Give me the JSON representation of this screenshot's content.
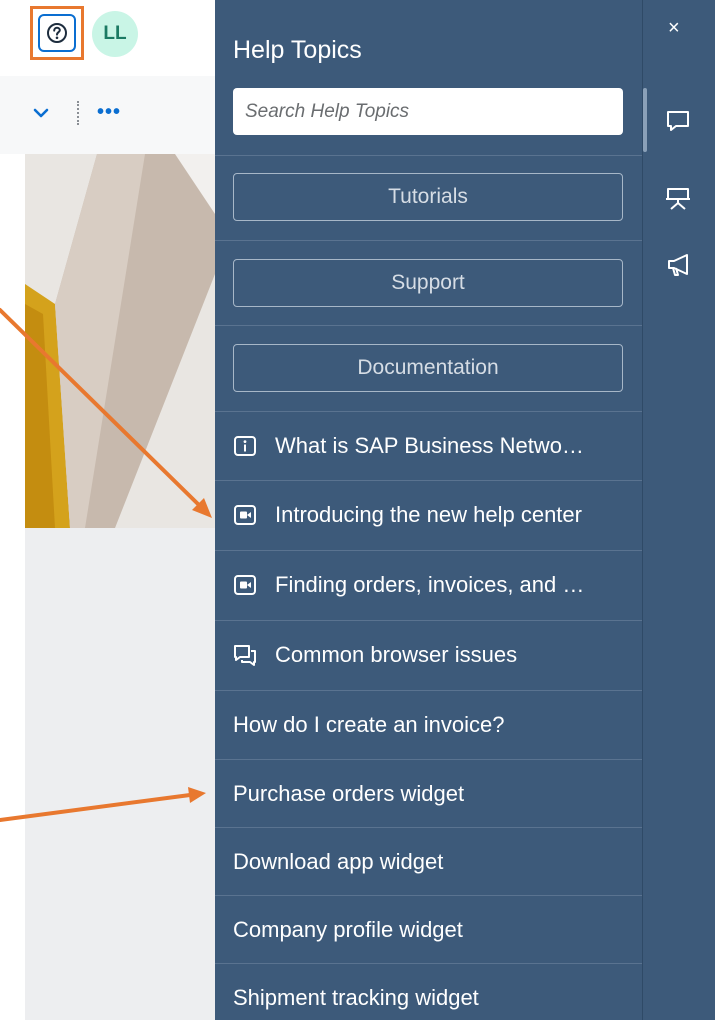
{
  "header": {
    "help_icon": "question-circle-icon",
    "avatar_initials": "LL"
  },
  "toolbar": {
    "chevron_icon": "chevron-down-icon",
    "more_label": "•••"
  },
  "help_panel": {
    "title": "Help Topics",
    "search_placeholder": "Search Help Topics",
    "buttons": [
      {
        "label": "Tutorials"
      },
      {
        "label": "Support"
      },
      {
        "label": "Documentation"
      }
    ],
    "topics": [
      {
        "label": "What is SAP Business Netwo…",
        "icon": "info-icon"
      },
      {
        "label": "Introducing the new help center",
        "icon": "video-icon"
      },
      {
        "label": "Finding orders, invoices, and …",
        "icon": "video-icon"
      },
      {
        "label": "Common browser issues",
        "icon": "conversation-icon"
      },
      {
        "label": "How do I create an invoice?",
        "icon": ""
      },
      {
        "label": "Purchase orders widget",
        "icon": ""
      },
      {
        "label": "Download app widget",
        "icon": ""
      },
      {
        "label": "Company profile widget",
        "icon": ""
      },
      {
        "label": "Shipment tracking widget",
        "icon": ""
      }
    ]
  },
  "rail": {
    "close_label": "×",
    "icons": [
      "feedback-icon",
      "presentation-icon",
      "announcement-icon"
    ]
  },
  "colors": {
    "panel_bg": "#3d5a7a",
    "annotation_orange": "#e8782f",
    "accent_blue": "#0a6ed1"
  }
}
